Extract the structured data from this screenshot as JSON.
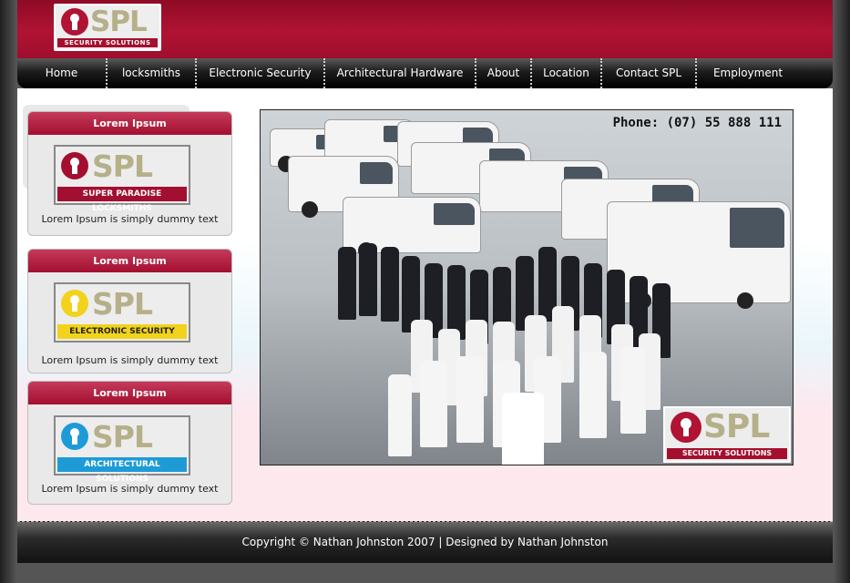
{
  "header": {
    "logo_main": "SPL",
    "logo_tag": "SECURITY SOLUTIONS"
  },
  "nav": {
    "items": [
      {
        "label": "Home"
      },
      {
        "label": "locksmiths"
      },
      {
        "label": "Electronic Security"
      },
      {
        "label": "Architectural Hardware"
      },
      {
        "label": "About"
      },
      {
        "label": "Location"
      },
      {
        "label": "Contact SPL"
      },
      {
        "label": "Employment"
      }
    ]
  },
  "sidebar": {
    "boxes": [
      {
        "title": "Lorem Ipsum",
        "badge_main": "SPL",
        "badge_strip": "SUPER PARADISE LOCKSMITHS",
        "text": "Lorem Ipsum is simply dummy text",
        "accent": "#a30f30",
        "strip_text_color": "#ffffff"
      },
      {
        "title": "Lorem Ipsum",
        "badge_main": "SPL",
        "badge_strip": "ELECTRONIC SECURITY",
        "text": "Lorem Ipsum is simply dummy text",
        "accent": "#f2d21b",
        "strip_text_color": "#222222"
      },
      {
        "title": "Lorem Ipsum",
        "badge_main": "SPL",
        "badge_strip": "ARCHITECTURAL SOLUTIONS",
        "text": "Lorem Ipsum is simply dummy text",
        "accent": "#1e9bd6",
        "strip_text_color": "#ffffff"
      }
    ]
  },
  "photo": {
    "phone": "Phone: (07) 55 888 111",
    "logo_main": "SPL",
    "logo_tag": "SECURITY SOLUTIONS"
  },
  "footer": {
    "text": "Copyright © Nathan Johnston 2007 | Designed by Nathan Johnston"
  }
}
